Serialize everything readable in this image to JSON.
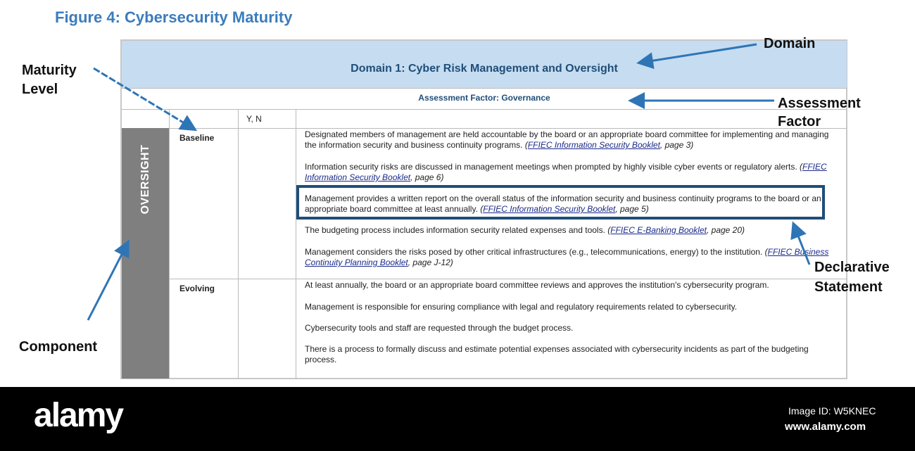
{
  "title": "Figure 4: Cybersecurity Maturity",
  "domain": "Domain 1: Cyber Risk Management and Oversight",
  "assessment_factor": "Assessment Factor: Governance",
  "yn_header": "Y, N",
  "component": "OVERSIGHT",
  "levels": [
    "Baseline",
    "Evolving"
  ],
  "baseline": [
    {
      "text": "Designated members of management are held accountable by the board or an appropriate board committee for implementing and managing the information security and business continuity programs. ",
      "ref": "FFIEC Information Security Booklet",
      "page": ", page 3)"
    },
    {
      "text": "Information security risks are discussed in management meetings when prompted by highly visible cyber events or regulatory alerts. ",
      "ref": "FFIEC Information Security Booklet",
      "page": ", page 6)"
    },
    {
      "text": "Management provides a written report on the overall status of the information security and business continuity programs to the board or an appropriate board committee at least annually. ",
      "ref": "FFIEC Information Security Booklet",
      "page": ", page 5)"
    },
    {
      "text": "The budgeting process includes information security related expenses and tools. ",
      "ref": "FFIEC E-Banking Booklet",
      "page": ", page 20)"
    },
    {
      "text": "Management considers the risks posed by other critical infrastructures (e.g., telecommunications, energy) to the institution. ",
      "ref": "FFIEC Business Continuity Planning Booklet",
      "page": ", page J-12)"
    }
  ],
  "evolving": [
    "At least annually, the board or an appropriate board committee reviews and approves the institution's cybersecurity program.",
    "Management is responsible for ensuring compliance with legal and regulatory requirements related to cybersecurity.",
    "Cybersecurity tools and staff are requested through the budget process.",
    "There is a process to formally discuss and estimate potential expenses associated with cybersecurity incidents as part of the budgeting process."
  ],
  "ref_open": "(",
  "labels": {
    "domain": "Domain",
    "assessment1": "Assessment",
    "assessment2": "Factor",
    "maturity1": "Maturity",
    "maturity2": "Level",
    "component": "Component",
    "declarative1": "Declarative",
    "declarative2": "Statement"
  },
  "footer": {
    "logo": "alamy",
    "image_id": "Image ID: W5KNEC",
    "url": "www.alamy.com"
  },
  "colors": {
    "arrow": "#2e75b6",
    "header": "#c6dcf0",
    "component": "#7f7f7f"
  }
}
